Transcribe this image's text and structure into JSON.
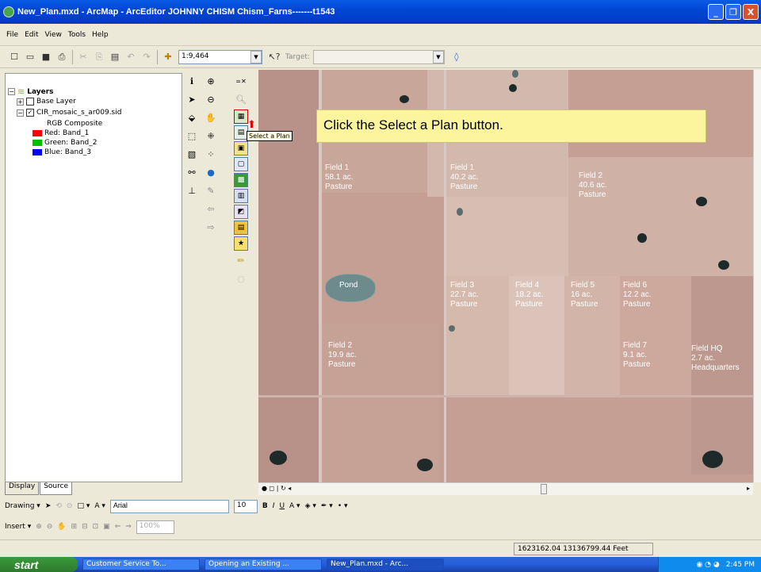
{
  "window": {
    "title": "New_Plan.mxd - ArcMap - ArcEditor       JOHNNY CHISM       Chism_Farns-------t1543",
    "minimize": "_",
    "maximize": "❐",
    "close": "X"
  },
  "menu": [
    "File",
    "Edit",
    "View",
    "Tools",
    "Help"
  ],
  "toolbar": {
    "scale": "1:9,464",
    "target_label": "Target:",
    "target_value": ""
  },
  "toc": {
    "root": "Layers",
    "layers": [
      {
        "name": "Base Layer",
        "checked": false
      },
      {
        "name": "CIR_mosaic_s_ar009.sid",
        "checked": true
      }
    ],
    "composite_label": "RGB Composite",
    "bands": [
      {
        "label": "Red:   Band_1",
        "color": "#ff0000"
      },
      {
        "label": "Green: Band_2",
        "color": "#00c000"
      },
      {
        "label": "Blue:  Band_3",
        "color": "#0000ff"
      }
    ],
    "tabs": [
      "Display",
      "Source"
    ]
  },
  "instruction": "Click the Select a Plan button.",
  "tooltip": "Select a Plan",
  "map_labels": [
    {
      "text": "Field 1\n58.1 ac.\nPasture"
    },
    {
      "text": "Field 1\n40.2 ac.\nPasture"
    },
    {
      "text": "Field 2\n40.6 ac.\nPasture"
    },
    {
      "text": "Pond"
    },
    {
      "text": "Field 3\n22.7 ac.\nPasture"
    },
    {
      "text": "Field 4\n18.2 ac.\nPasture"
    },
    {
      "text": "Field 5\n16 ac.\nPasture"
    },
    {
      "text": "Field 6\n12.2 ac.\nPasture"
    },
    {
      "text": "Field 2\n19.9 ac.\nPasture"
    },
    {
      "text": "Field 7\n9.1 ac.\nPasture"
    },
    {
      "text": "Field HQ\n2.7 ac.\nHeadquarters"
    }
  ],
  "drawing_toolbar": {
    "drawing_label": "Drawing",
    "font": "Arial",
    "font_size": "10",
    "bold": "B",
    "italic": "I",
    "underline": "U"
  },
  "insert_toolbar": {
    "insert_label": "Insert",
    "zoom": "100%"
  },
  "status": {
    "coords": "1623162.04  13136799.44 Feet"
  },
  "taskbar": {
    "start": "start",
    "tasks": [
      "Customer Service To...",
      "Opening an Existing ...",
      "New_Plan.mxd - Arc..."
    ],
    "clock": "2:45 PM"
  },
  "colors": {
    "title_bar": "#0a5ce8",
    "map_background": "#c59f93",
    "instruction_bg": "#fdf59e"
  }
}
